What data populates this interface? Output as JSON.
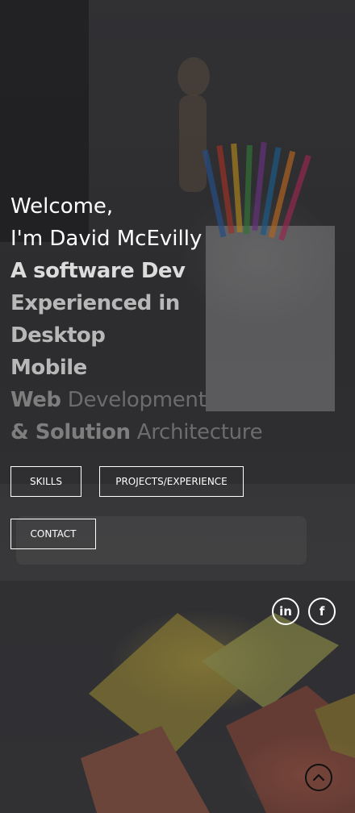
{
  "hero": {
    "line1": "Welcome,",
    "line2": "I'm David McEvilly",
    "line3": "A software Dev",
    "line4": "Experienced in",
    "line5": "Desktop",
    "line6": "Mobile",
    "line7a": "Web",
    "line7b": "Development",
    "line8a": "& Solution",
    "line8b": "Architecture"
  },
  "buttons": {
    "skills": "SKILLS",
    "projects": "PROJECTS/EXPERIENCE",
    "contact": "CONTACT"
  },
  "social": {
    "linkedin_icon": "linkedin-icon",
    "linkedin_text": "in",
    "facebook_icon": "facebook-icon",
    "facebook_text": "f"
  },
  "scroll": {
    "icon": "chevron-up-icon"
  },
  "colors": {
    "text_primary": "#ffffff",
    "text_dim": "#7e7e7e"
  }
}
